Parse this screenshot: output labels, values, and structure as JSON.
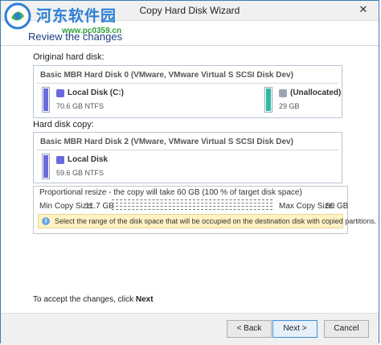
{
  "window": {
    "title": "Copy Hard Disk Wizard",
    "close_glyph": "✕"
  },
  "watermark": {
    "site_name": "河东软件园",
    "url": "www.pc0359.cn"
  },
  "page": {
    "heading": "Review the changes"
  },
  "original_disk": {
    "section_label": "Original hard disk:",
    "title": "Basic MBR Hard Disk 0 (VMware, VMware Virtual S SCSI Disk Dev)",
    "partitions": [
      {
        "name": "Local Disk (C:)",
        "size": "70.6 GB NTFS",
        "color": "#6a6adf"
      },
      {
        "name": "(Unallocated)",
        "size": "29 GB",
        "color": "#2fb8a8"
      }
    ]
  },
  "copy_disk": {
    "section_label": "Hard disk copy:",
    "title": "Basic MBR Hard Disk 2 (VMware, VMware Virtual S SCSI Disk Dev)",
    "partitions": [
      {
        "name": "Local Disk",
        "size": "59.6 GB NTFS",
        "color": "#6a6adf"
      }
    ]
  },
  "resize": {
    "legend": "Proportional resize - the copy will take 60 GB (100 % of target disk space)",
    "min_label": "Min Copy Size:",
    "min_value": "11.7 GB",
    "max_label": "Max Copy Size:",
    "max_value": "60 GB",
    "info": "Select the range of the disk space that will be occupied on the destination disk with copied partitions."
  },
  "accept": {
    "prefix": "To accept the changes, click",
    "action": "Next"
  },
  "buttons": {
    "back": "< Back",
    "next": "Next >",
    "cancel": "Cancel"
  }
}
